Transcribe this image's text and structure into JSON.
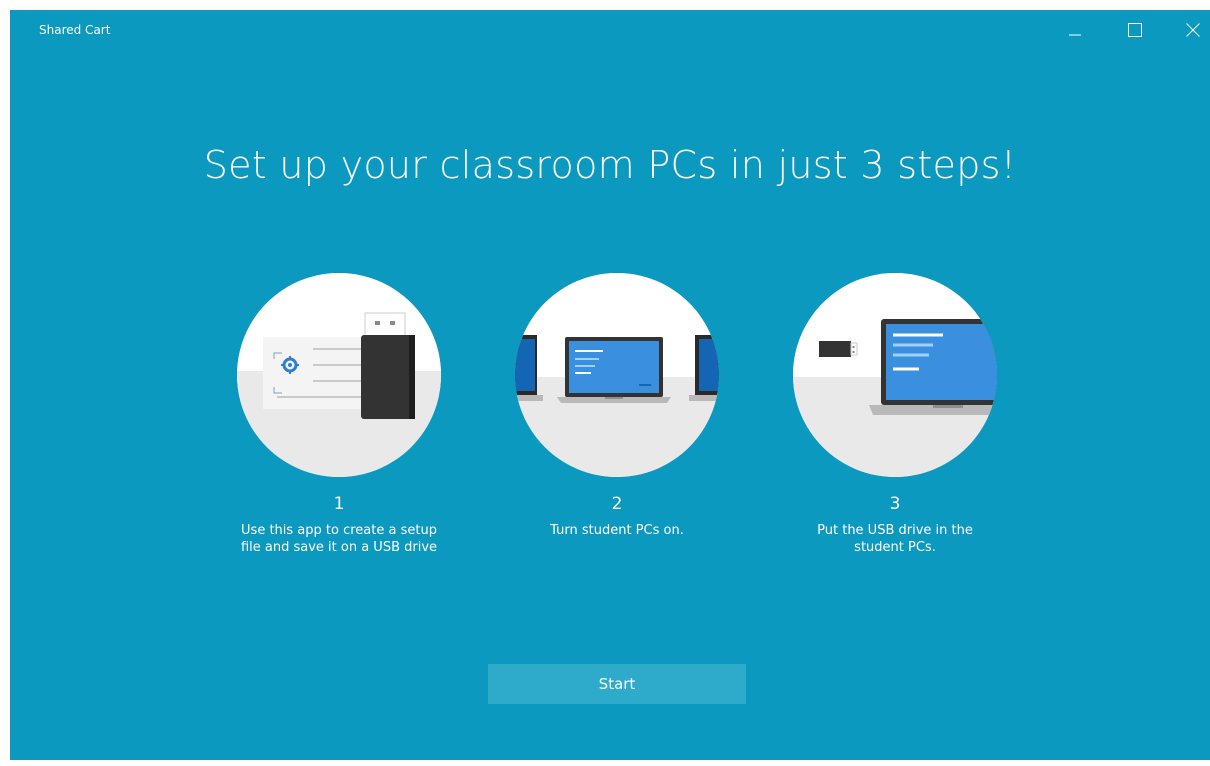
{
  "window": {
    "title": "Shared Cart"
  },
  "main": {
    "heading": "Set up your classroom PCs in just 3 steps!",
    "steps": [
      {
        "number": "1",
        "description": "Use this app to create a setup file and save it on a USB drive",
        "illustration": "usb-drive-setup-file"
      },
      {
        "number": "2",
        "description": "Turn student PCs on.",
        "illustration": "laptops-row"
      },
      {
        "number": "3",
        "description": "Put the USB drive in the student PCs.",
        "illustration": "usb-into-laptop"
      }
    ],
    "start_label": "Start"
  },
  "colors": {
    "background": "#0b99bf",
    "button": "#2eaacb",
    "screen_blue": "#3a8fde",
    "text": "#ffffff"
  }
}
